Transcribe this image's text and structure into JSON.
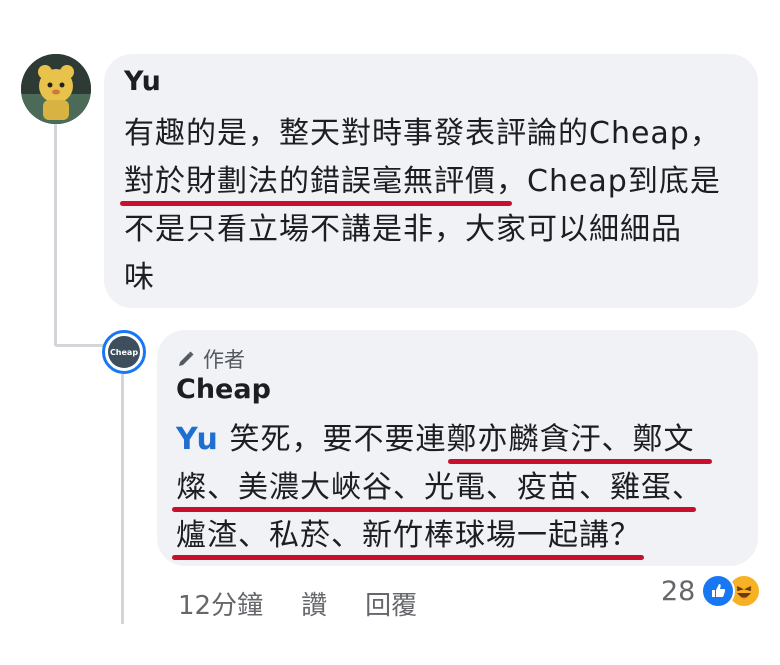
{
  "parent_comment": {
    "author": "Yu",
    "lines": [
      "有趣的是，整天對時事發表評論的Cheap，",
      "對於財劃法的錯誤毫無評價，Cheap到底是",
      "不是只看立場不講是非，大家可以細細品",
      "味"
    ]
  },
  "reply": {
    "author_tag": "作者",
    "author": "Cheap",
    "avatar_label": "Cheap",
    "mention": "Yu",
    "lines": [
      " 笑死，要不要連鄭亦麟貪汙、鄭文",
      "燦、美濃大峽谷、光電、疫苗、雞蛋、",
      "爐渣、私菸、新竹棒球場一起講？"
    ],
    "time": "12分鐘",
    "like_label": "讚",
    "reply_label": "回覆",
    "reaction_count": "28",
    "colors": {
      "like": "#1877f2",
      "haha": "#f7b125",
      "underline": "#c8102e"
    }
  }
}
